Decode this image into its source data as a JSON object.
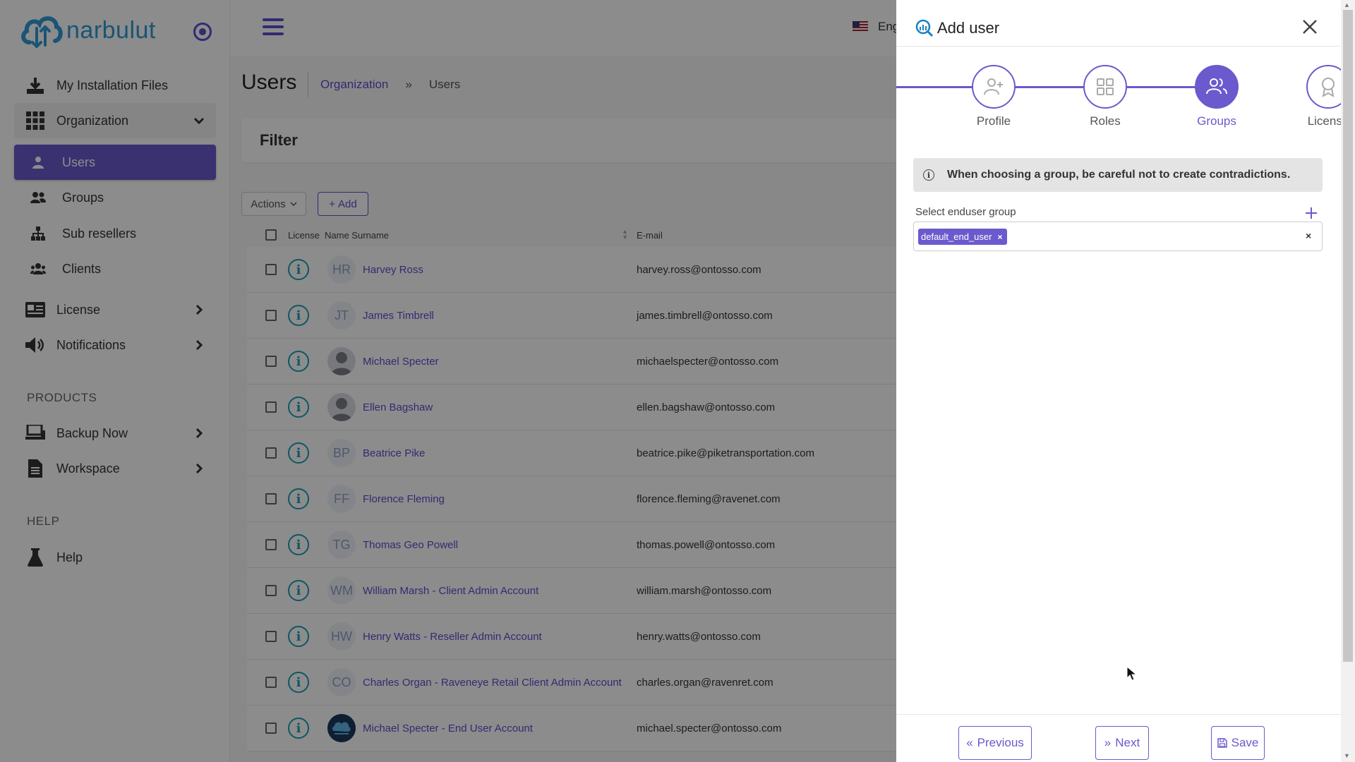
{
  "app": {
    "logo_text": "narbulut"
  },
  "sidebar": {
    "items": [
      {
        "label": "My Installation Files",
        "icon": "download-icon"
      },
      {
        "label": "Organization",
        "icon": "grid-icon"
      },
      {
        "label": "License",
        "icon": "license-card-icon"
      },
      {
        "label": "Notifications",
        "icon": "speaker-icon"
      }
    ],
    "sub_items": [
      {
        "label": "Users",
        "icon": "user-icon"
      },
      {
        "label": "Groups",
        "icon": "users-icon"
      },
      {
        "label": "Sub resellers",
        "icon": "hierarchy-icon"
      },
      {
        "label": "Clients",
        "icon": "clients-icon"
      }
    ],
    "products_title": "PRODUCTS",
    "products": [
      {
        "label": "Backup Now",
        "icon": "computer-icon"
      },
      {
        "label": "Workspace",
        "icon": "document-icon"
      }
    ],
    "help_title": "HELP",
    "help_items": [
      {
        "label": "Help",
        "icon": "flask-icon"
      }
    ]
  },
  "topbar": {
    "language": "Eng"
  },
  "main": {
    "title": "Users",
    "breadcrumb": {
      "link": "Organization",
      "separator": "»",
      "current": "Users"
    },
    "filter_title": "Filter",
    "actions_label": "Actions",
    "add_label": "Add",
    "table": {
      "headers": {
        "license": "License",
        "name": "Name Surname",
        "email": "E-mail"
      },
      "rows": [
        {
          "initials": "HR",
          "name": "Harvey Ross",
          "email": "harvey.ross@ontosso.com",
          "avatar": "initials"
        },
        {
          "initials": "JT",
          "name": "James Timbrell",
          "email": "james.timbrell@ontosso.com",
          "avatar": "initials"
        },
        {
          "initials": "",
          "name": "Michael Specter",
          "email": "michaelspecter@ontosso.com",
          "avatar": "photo"
        },
        {
          "initials": "",
          "name": "Ellen Bagshaw",
          "email": "ellen.bagshaw@ontosso.com",
          "avatar": "photo"
        },
        {
          "initials": "BP",
          "name": "Beatrice Pike",
          "email": "beatrice.pike@piketransportation.com",
          "avatar": "initials"
        },
        {
          "initials": "FF",
          "name": "Florence Fleming",
          "email": "florence.fleming@ravenet.com",
          "avatar": "initials"
        },
        {
          "initials": "TG",
          "name": "Thomas Geo Powell",
          "email": "thomas.powell@ontosso.com",
          "avatar": "initials"
        },
        {
          "initials": "WM",
          "name": "William Marsh - Client Admin Account",
          "email": "william.marsh@ontosso.com",
          "avatar": "initials"
        },
        {
          "initials": "HW",
          "name": "Henry Watts - Reseller Admin Account",
          "email": "henry.watts@ontosso.com",
          "avatar": "initials"
        },
        {
          "initials": "CO",
          "name": "Charles Organ - Raveneye Retail Client Admin Account",
          "email": "charles.organ@ravenret.com",
          "avatar": "initials"
        },
        {
          "initials": "",
          "name": "Michael Specter - End User Account",
          "email": "michael.specter@ontosso.com",
          "avatar": "logo"
        }
      ]
    }
  },
  "panel": {
    "title": "Add user",
    "steps": [
      {
        "label": "Profile",
        "icon": "user-plus-icon",
        "active": false
      },
      {
        "label": "Roles",
        "icon": "grid-icon",
        "active": false
      },
      {
        "label": "Groups",
        "icon": "users-icon",
        "active": true
      },
      {
        "label": "License",
        "icon": "award-icon",
        "active": false
      }
    ],
    "alert": "When choosing a group, be careful not to create contradictions.",
    "field_label": "Select enduser group",
    "selected_tag": "default_end_user",
    "tag_remove": "×",
    "clear": "×",
    "footer": {
      "previous": "Previous",
      "next": "Next",
      "save": "Save"
    }
  },
  "colors": {
    "accent": "#6a5acd",
    "info": "#1a9fb5",
    "logo": "#2e9bd6"
  }
}
